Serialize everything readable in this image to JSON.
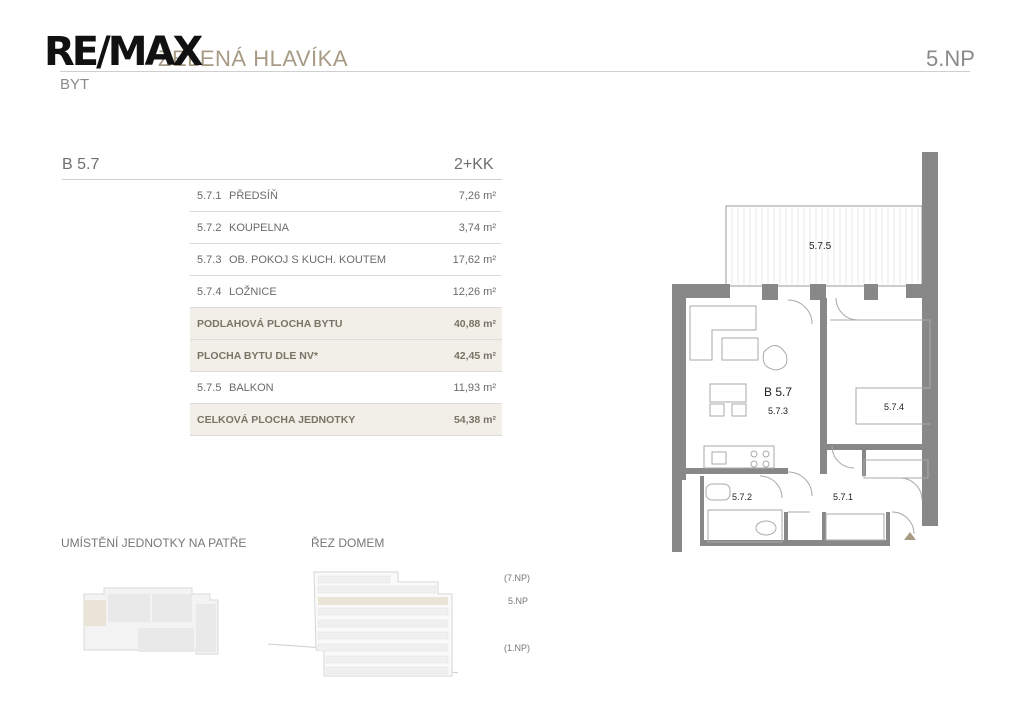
{
  "header": {
    "logo": "RE/MAX",
    "project": "ZELENÁ HLAVÍKA",
    "floor": "5.NP",
    "subtitle": "BYT"
  },
  "unit": {
    "code": "B 5.7",
    "type": "2+KK"
  },
  "rooms": [
    {
      "num": "5.7.1",
      "name": "PŘEDSÍŇ",
      "area": "7,26 m²"
    },
    {
      "num": "5.7.2",
      "name": "KOUPELNA",
      "area": "3,74 m²"
    },
    {
      "num": "5.7.3",
      "name": "OB. POKOJ S KUCH. KOUTEM",
      "area": "17,62 m²"
    },
    {
      "num": "5.7.4",
      "name": "LOŽNICE",
      "area": "12,26 m²"
    }
  ],
  "sums": {
    "floor_area_label": "PODLAHOVÁ PLOCHA BYTU",
    "floor_area": "40,88 m²",
    "nv_area_label": "PLOCHA BYTU DLE NV*",
    "nv_area": "42,45 m²",
    "balcony_num": "5.7.5",
    "balcony_label": "BALKON",
    "balcony_area": "11,93 m²",
    "total_label": "CELKOVÁ PLOCHA JEDNOTKY",
    "total_area": "54,38 m²"
  },
  "plan_labels": {
    "unit": "B 5.7",
    "living": "5.7.3",
    "bedroom": "5.7.4",
    "bath": "5.7.2",
    "hall": "5.7.1",
    "balcony": "5.7.5"
  },
  "location": {
    "title": "UMÍSTĚNÍ JEDNOTKY NA PATŘE"
  },
  "section": {
    "title": "ŘEZ DOMEM",
    "top": "(7.NP)",
    "current": "5.NP",
    "bottom": "(1.NP)"
  },
  "colors": {
    "accent": "#a79b85",
    "highlight": "#f2efe8",
    "wall": "#888888"
  }
}
